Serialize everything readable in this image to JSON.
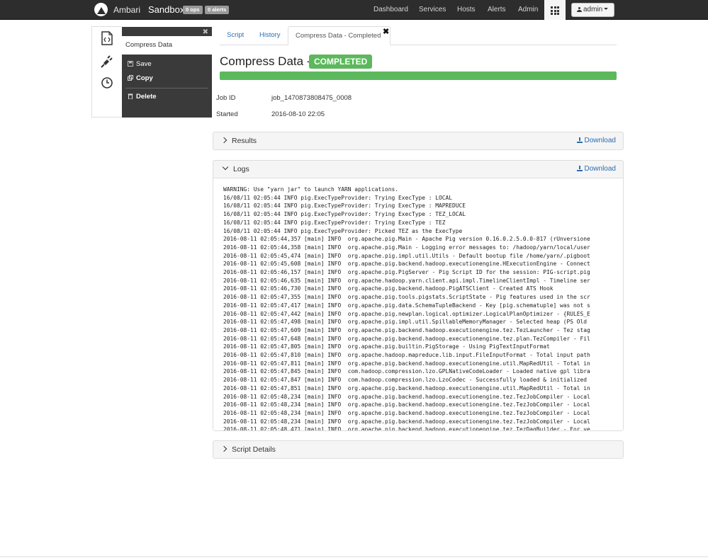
{
  "navbar": {
    "brand": "Ambari",
    "cluster": "Sandbox",
    "ops_badge": "0 ops",
    "alerts_badge": "0 alerts",
    "links": [
      "Dashboard",
      "Services",
      "Hosts",
      "Alerts",
      "Admin"
    ],
    "user": "admin"
  },
  "rail": {
    "icons": [
      "script-icon",
      "plug-icon",
      "clock-icon"
    ]
  },
  "script_panel": {
    "title": "Compress Data",
    "save_label": "Save",
    "copy_label": "Copy",
    "delete_label": "Delete"
  },
  "tabs": {
    "script": "Script",
    "history": "History",
    "active": "Compress Data - Completed"
  },
  "job": {
    "title": "Compress Data -",
    "status": "COMPLETED",
    "progress_percent": 100,
    "job_id_label": "Job ID",
    "job_id": "job_1470873808475_0008",
    "started_label": "Started",
    "started": "2016-08-10 22:05"
  },
  "results": {
    "label": "Results",
    "download": "Download"
  },
  "logs": {
    "label": "Logs",
    "download": "Download",
    "lines": [
      "WARNING: Use \"yarn jar\" to launch YARN applications.",
      "16/08/11 02:05:44 INFO pig.ExecTypeProvider: Trying ExecType : LOCAL",
      "16/08/11 02:05:44 INFO pig.ExecTypeProvider: Trying ExecType : MAPREDUCE",
      "16/08/11 02:05:44 INFO pig.ExecTypeProvider: Trying ExecType : TEZ_LOCAL",
      "16/08/11 02:05:44 INFO pig.ExecTypeProvider: Trying ExecType : TEZ",
      "16/08/11 02:05:44 INFO pig.ExecTypeProvider: Picked TEZ as the ExecType",
      "2016-08-11 02:05:44,357 [main] INFO  org.apache.pig.Main - Apache Pig version 0.16.0.2.5.0.0-817 (rUnversione",
      "2016-08-11 02:05:44,358 [main] INFO  org.apache.pig.Main - Logging error messages to: /hadoop/yarn/local/user",
      "2016-08-11 02:05:45,474 [main] INFO  org.apache.pig.impl.util.Utils - Default bootup file /home/yarn/.pigboot",
      "2016-08-11 02:05:45,608 [main] INFO  org.apache.pig.backend.hadoop.executionengine.HExecutionEngine - Connect",
      "2016-08-11 02:05:46,157 [main] INFO  org.apache.pig.PigServer - Pig Script ID for the session: PIG-script.pig",
      "2016-08-11 02:05:46,635 [main] INFO  org.apache.hadoop.yarn.client.api.impl.TimelineClientImpl - Timeline ser",
      "2016-08-11 02:05:46,730 [main] INFO  org.apache.pig.backend.hadoop.PigATSClient - Created ATS Hook",
      "2016-08-11 02:05:47,355 [main] INFO  org.apache.pig.tools.pigstats.ScriptState - Pig features used in the scr",
      "2016-08-11 02:05:47,417 [main] INFO  org.apache.pig.data.SchemaTupleBackend - Key [pig.schematuple] was not s",
      "2016-08-11 02:05:47,442 [main] INFO  org.apache.pig.newplan.logical.optimizer.LogicalPlanOptimizer - {RULES_E",
      "2016-08-11 02:05:47,498 [main] INFO  org.apache.pig.impl.util.SpillableMemoryManager - Selected heap (PS Old ",
      "2016-08-11 02:05:47,609 [main] INFO  org.apache.pig.backend.hadoop.executionengine.tez.TezLauncher - Tez stag",
      "2016-08-11 02:05:47,648 [main] INFO  org.apache.pig.backend.hadoop.executionengine.tez.plan.TezCompiler - Fil",
      "2016-08-11 02:05:47,805 [main] INFO  org.apache.pig.builtin.PigStorage - Using PigTextInputFormat",
      "2016-08-11 02:05:47,810 [main] INFO  org.apache.hadoop.mapreduce.lib.input.FileInputFormat - Total input path",
      "2016-08-11 02:05:47,811 [main] INFO  org.apache.pig.backend.hadoop.executionengine.util.MapRedUtil - Total in",
      "2016-08-11 02:05:47,845 [main] INFO  com.hadoop.compression.lzo.GPLNativeCodeLoader - Loaded native gpl libra",
      "2016-08-11 02:05:47,847 [main] INFO  com.hadoop.compression.lzo.LzoCodec - Successfully loaded & initialized ",
      "2016-08-11 02:05:47,851 [main] INFO  org.apache.pig.backend.hadoop.executionengine.util.MapRedUtil - Total in",
      "2016-08-11 02:05:48,234 [main] INFO  org.apache.pig.backend.hadoop.executionengine.tez.TezJobCompiler - Local",
      "2016-08-11 02:05:48,234 [main] INFO  org.apache.pig.backend.hadoop.executionengine.tez.TezJobCompiler - Local",
      "2016-08-11 02:05:48,234 [main] INFO  org.apache.pig.backend.hadoop.executionengine.tez.TezJobCompiler - Local",
      "2016-08-11 02:05:48,234 [main] INFO  org.apache.pig.backend.hadoop.executionengine.tez.TezJobCompiler - Local",
      "2016-08-11 02:05:48,471 [main] INFO  org.apache.pig.backend.hadoop.executionengine.tez.TezDagBuilder - For ve"
    ]
  },
  "script_details": {
    "label": "Script Details"
  }
}
